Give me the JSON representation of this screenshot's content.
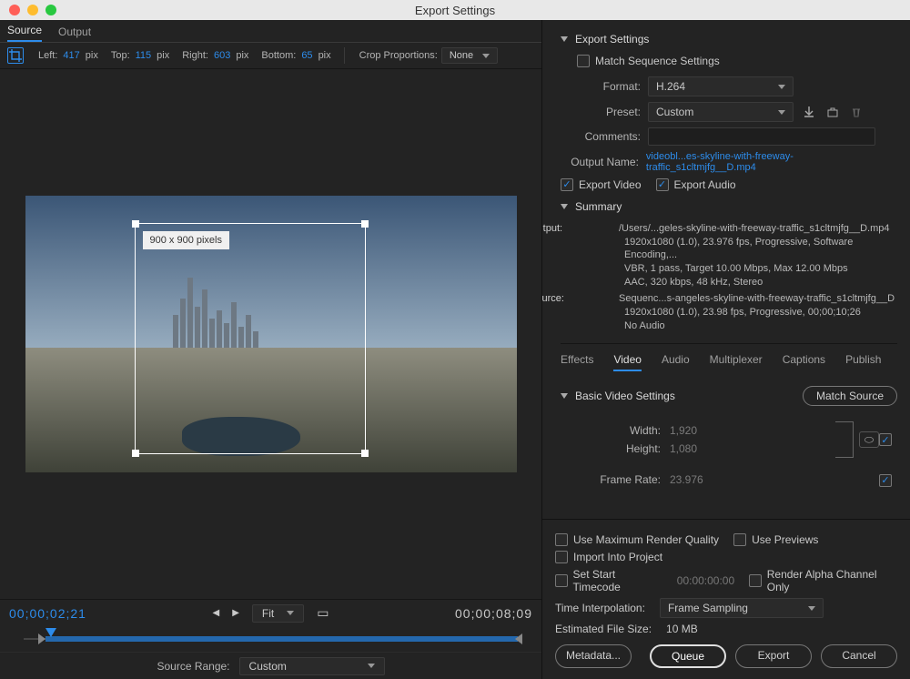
{
  "window_title": "Export Settings",
  "tabs": {
    "source": "Source",
    "output": "Output"
  },
  "crop": {
    "left_label": "Left:",
    "left": "417",
    "top_label": "Top:",
    "top": "115",
    "right_label": "Right:",
    "right": "603",
    "bottom_label": "Bottom:",
    "bottom": "65",
    "unit": "pix",
    "prop_label": "Crop Proportions:",
    "prop_value": "None",
    "size_label": "900 x 900 pixels"
  },
  "playback": {
    "current_tc": "00;00;02;21",
    "fit_label": "Fit",
    "duration_tc": "00;00;08;09",
    "source_range_label": "Source Range:",
    "source_range_value": "Custom"
  },
  "export_settings": {
    "header": "Export Settings",
    "match_seq": "Match Sequence Settings",
    "format_label": "Format:",
    "format_value": "H.264",
    "preset_label": "Preset:",
    "preset_value": "Custom",
    "comments_label": "Comments:",
    "output_name_label": "Output Name:",
    "output_name_value": "videobl...es-skyline-with-freeway-traffic_s1cltmjfg__D.mp4",
    "export_video": "Export Video",
    "export_audio": "Export Audio",
    "summary_header": "Summary",
    "summary": {
      "output_label": "Output:",
      "output_l1": "/Users/...geles-skyline-with-freeway-traffic_s1cltmjfg__D.mp4",
      "output_l2": "1920x1080 (1.0), 23.976 fps, Progressive, Software Encoding,...",
      "output_l3": "VBR, 1 pass, Target 10.00 Mbps, Max 12.00 Mbps",
      "output_l4": "AAC, 320 kbps, 48 kHz, Stereo",
      "source_label": "Source:",
      "source_l1": "Sequenc...s-angeles-skyline-with-freeway-traffic_s1cltmjfg__D",
      "source_l2": "1920x1080 (1.0), 23.98 fps, Progressive, 00;00;10;26",
      "source_l3": "No Audio"
    }
  },
  "mid_tabs": {
    "effects": "Effects",
    "video": "Video",
    "audio": "Audio",
    "multiplexer": "Multiplexer",
    "captions": "Captions",
    "publish": "Publish"
  },
  "video_settings": {
    "header": "Basic Video Settings",
    "match_source": "Match Source",
    "width_label": "Width:",
    "width": "1,920",
    "height_label": "Height:",
    "height": "1,080",
    "fr_label": "Frame Rate:",
    "fr": "23.976"
  },
  "bottom": {
    "use_max": "Use Maximum Render Quality",
    "use_previews": "Use Previews",
    "import_project": "Import Into Project",
    "set_start_tc": "Set Start Timecode",
    "start_tc": "00:00:00:00",
    "render_alpha": "Render Alpha Channel Only",
    "time_interp_label": "Time Interpolation:",
    "time_interp_value": "Frame Sampling",
    "est_label": "Estimated File Size:",
    "est_value": "10 MB",
    "metadata": "Metadata...",
    "queue": "Queue",
    "export": "Export",
    "cancel": "Cancel"
  }
}
